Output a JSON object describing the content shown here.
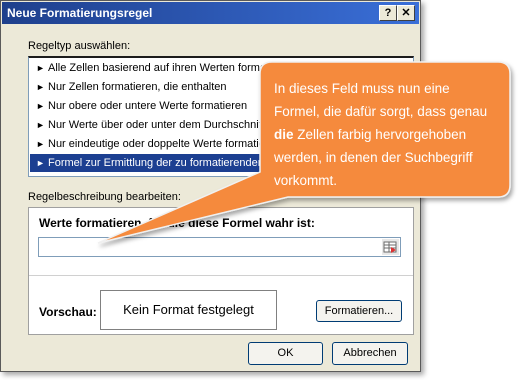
{
  "dialog": {
    "title": "Neue Formatierungsregel",
    "help_glyph": "?",
    "close_glyph": "✕",
    "section_type_label": "Regeltyp auswählen:",
    "rule_types": [
      "Alle Zellen basierend auf ihren Werten formatieren",
      "Nur Zellen formatieren, die enthalten",
      "Nur obere oder untere Werte formatieren",
      "Nur Werte über oder unter dem Durchschnitt formatieren",
      "Nur eindeutige oder doppelte Werte formatieren",
      "Formel zur Ermittlung der zu formatierenden Zellen verwenden"
    ],
    "selected_rule_index": 5,
    "section_desc_label": "Regelbeschreibung bearbeiten:",
    "formula_label": "Werte formatieren, für die diese Formel wahr ist:",
    "formula_value": "",
    "preview_label": "Vorschau:",
    "preview_text": "Kein Format festgelegt",
    "format_button": "Formatieren...",
    "ok_button": "OK",
    "cancel_button": "Abbrechen"
  },
  "callout": {
    "text_before": "In dieses Feld muss nun eine Formel, die dafür sorgt, dass genau ",
    "text_bold": "die",
    "text_after": " Zellen farbig hervorgehoben werden, in denen der Suchbegriff vorkommt.",
    "color": "#f58a3c"
  },
  "colors": {
    "title_bar": "#1e3f8c",
    "selection": "#1c3f91",
    "dialog_bg": "#ece9d8"
  }
}
